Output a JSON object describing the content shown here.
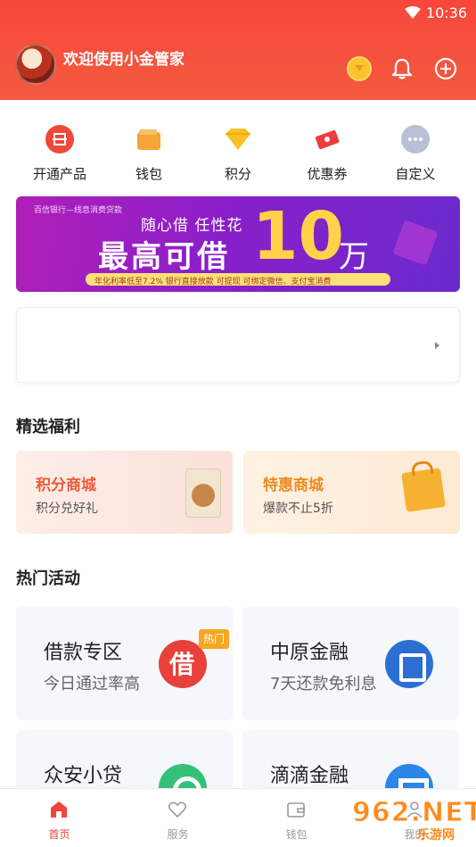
{
  "status": {
    "time": "10:36"
  },
  "header": {
    "welcome": "欢迎使用小金管家"
  },
  "quick_menu": [
    {
      "label": "开通产品",
      "icon": "open-product-icon",
      "color": "#f0483a"
    },
    {
      "label": "钱包",
      "icon": "wallet-icon",
      "color": "#f7a437"
    },
    {
      "label": "积分",
      "icon": "points-diamond-icon",
      "color": "#f7c324"
    },
    {
      "label": "优惠券",
      "icon": "coupon-icon",
      "color": "#ee3d3d"
    },
    {
      "label": "自定义",
      "icon": "more-icon",
      "color": "#b7c1d3"
    }
  ],
  "banner": {
    "small": "百信银行—线息消费贷款",
    "sub": "随心借  任性花",
    "main": "最高可借",
    "big": "10",
    "unit": "万",
    "note": "年化利率低至7.2%  银行直接放款  可提现  可绑定微信、支付宝消费"
  },
  "sections": {
    "welfare": "精选福利",
    "activities": "热门活动"
  },
  "welfare": [
    {
      "title": "积分商城",
      "sub": "积分兑好礼"
    },
    {
      "title": "特惠商城",
      "sub": "爆款不止5折"
    }
  ],
  "activities": [
    {
      "title": "借款专区",
      "sub": "今日通过率高",
      "badge": "热门"
    },
    {
      "title": "中原金融",
      "sub": "7天还款免利息"
    },
    {
      "title": "众安小贷",
      "sub": ""
    },
    {
      "title": "滴滴金融",
      "sub": ""
    }
  ],
  "bottom_nav": [
    {
      "label": "首页",
      "active": true
    },
    {
      "label": "服务",
      "active": false
    },
    {
      "label": "钱包",
      "active": false
    },
    {
      "label": "我的",
      "active": false
    }
  ],
  "watermark": {
    "num": "962.NET",
    "text": "乐游网"
  }
}
